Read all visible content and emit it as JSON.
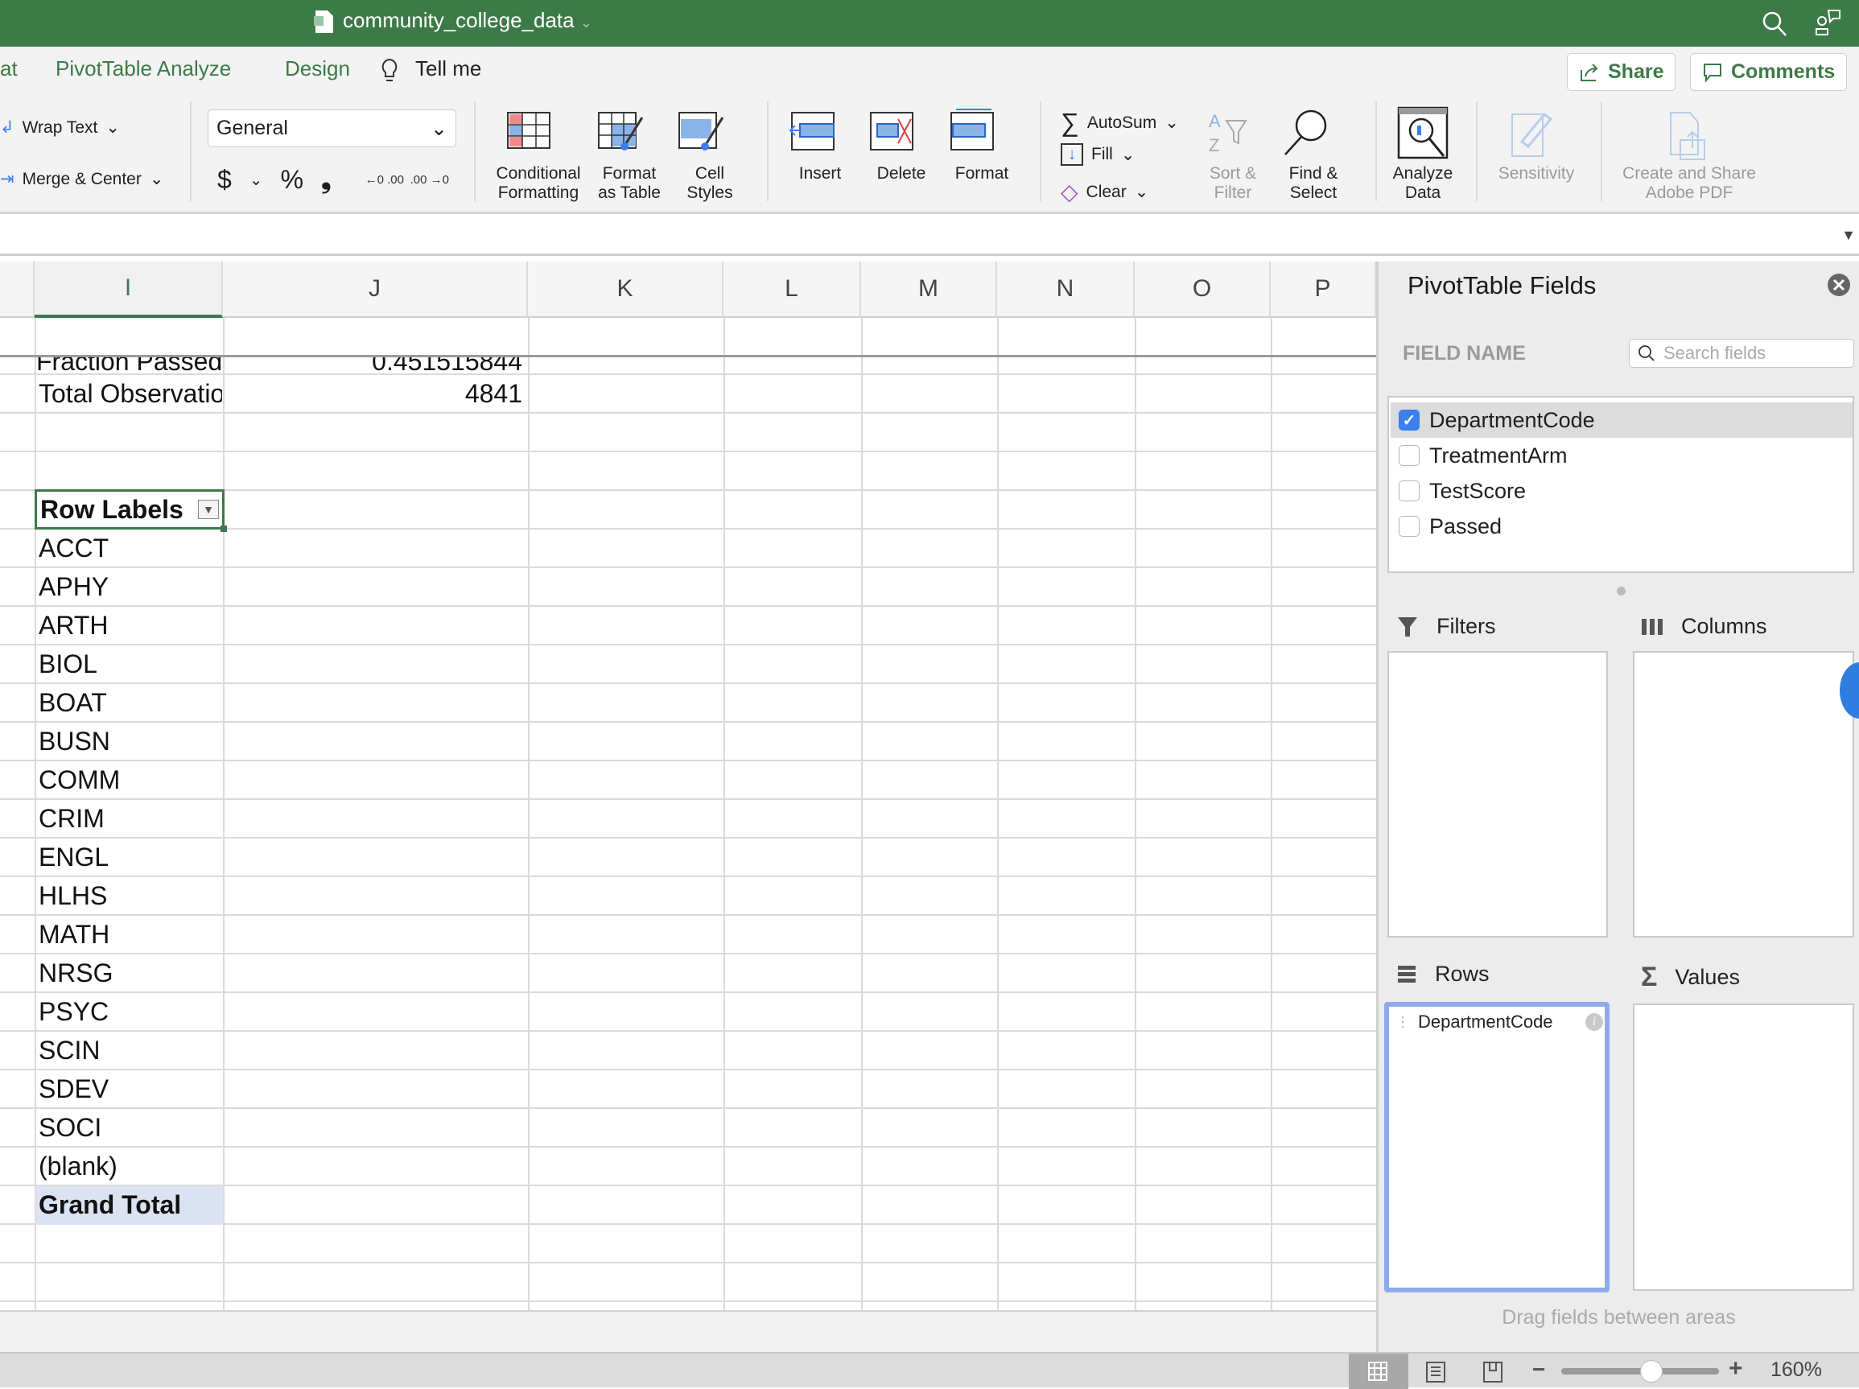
{
  "window": {
    "title": "community_college_data"
  },
  "tabs": {
    "partial": "at",
    "pivot_analyze": "PivotTable Analyze",
    "design": "Design",
    "tell_me": "Tell me"
  },
  "header_buttons": {
    "share": "Share",
    "comments": "Comments"
  },
  "ribbon": {
    "wrap_text": "Wrap Text",
    "merge_center": "Merge & Center",
    "number_format": "General",
    "currency": "$",
    "percent": "%",
    "comma": "❟",
    "inc_decimal": "←0 .00",
    "dec_decimal": ".00 →0",
    "conditional_formatting": [
      "Conditional",
      "Formatting"
    ],
    "format_as_table": [
      "Format",
      "as Table"
    ],
    "cell_styles": [
      "Cell",
      "Styles"
    ],
    "insert": "Insert",
    "delete": "Delete",
    "format": "Format",
    "autosum": "AutoSum",
    "fill": "Fill",
    "clear": "Clear",
    "sort_filter": [
      "Sort &",
      "Filter"
    ],
    "find_select": [
      "Find &",
      "Select"
    ],
    "analyze_data": [
      "Analyze",
      "Data"
    ],
    "sensitivity": "Sensitivity",
    "adobe_pdf": [
      "Create and Share",
      "Adobe PDF"
    ]
  },
  "sheet": {
    "columns": [
      "I",
      "J",
      "K",
      "L",
      "M",
      "N",
      "O",
      "P"
    ],
    "selected_column": "I",
    "partial_row": {
      "label": "Fraction Passed",
      "value": "0.451515844"
    },
    "total_obs": {
      "label": "Total Observations",
      "value": "4841"
    },
    "pivot_header": "Row Labels",
    "pivot_rows": [
      "ACCT",
      "APHY",
      "ARTH",
      "BIOL",
      "BOAT",
      "BUSN",
      "COMM",
      "CRIM",
      "ENGL",
      "HLHS",
      "MATH",
      "NRSG",
      "PSYC",
      "SCIN",
      "SDEV",
      "SOCI",
      "(blank)"
    ],
    "grand_total": "Grand Total"
  },
  "pivot_panel": {
    "title": "PivotTable Fields",
    "field_name_header": "FIELD NAME",
    "search_placeholder": "Search fields",
    "fields": [
      {
        "name": "DepartmentCode",
        "checked": true
      },
      {
        "name": "TreatmentArm",
        "checked": false
      },
      {
        "name": "TestScore",
        "checked": false
      },
      {
        "name": "Passed",
        "checked": false
      }
    ],
    "areas": {
      "filters": "Filters",
      "columns": "Columns",
      "rows": "Rows",
      "values": "Values"
    },
    "rows_items": [
      "DepartmentCode"
    ],
    "hint": "Drag fields between areas"
  },
  "status": {
    "zoom": "160%",
    "zoom_level_percent": 160,
    "minus": "−",
    "plus": "+"
  },
  "colors": {
    "brand": "#3c7a47",
    "checkbox": "#3b7ff0",
    "rows_focus": "#8eaaea",
    "grand_total_bg": "#dbe3f3"
  }
}
